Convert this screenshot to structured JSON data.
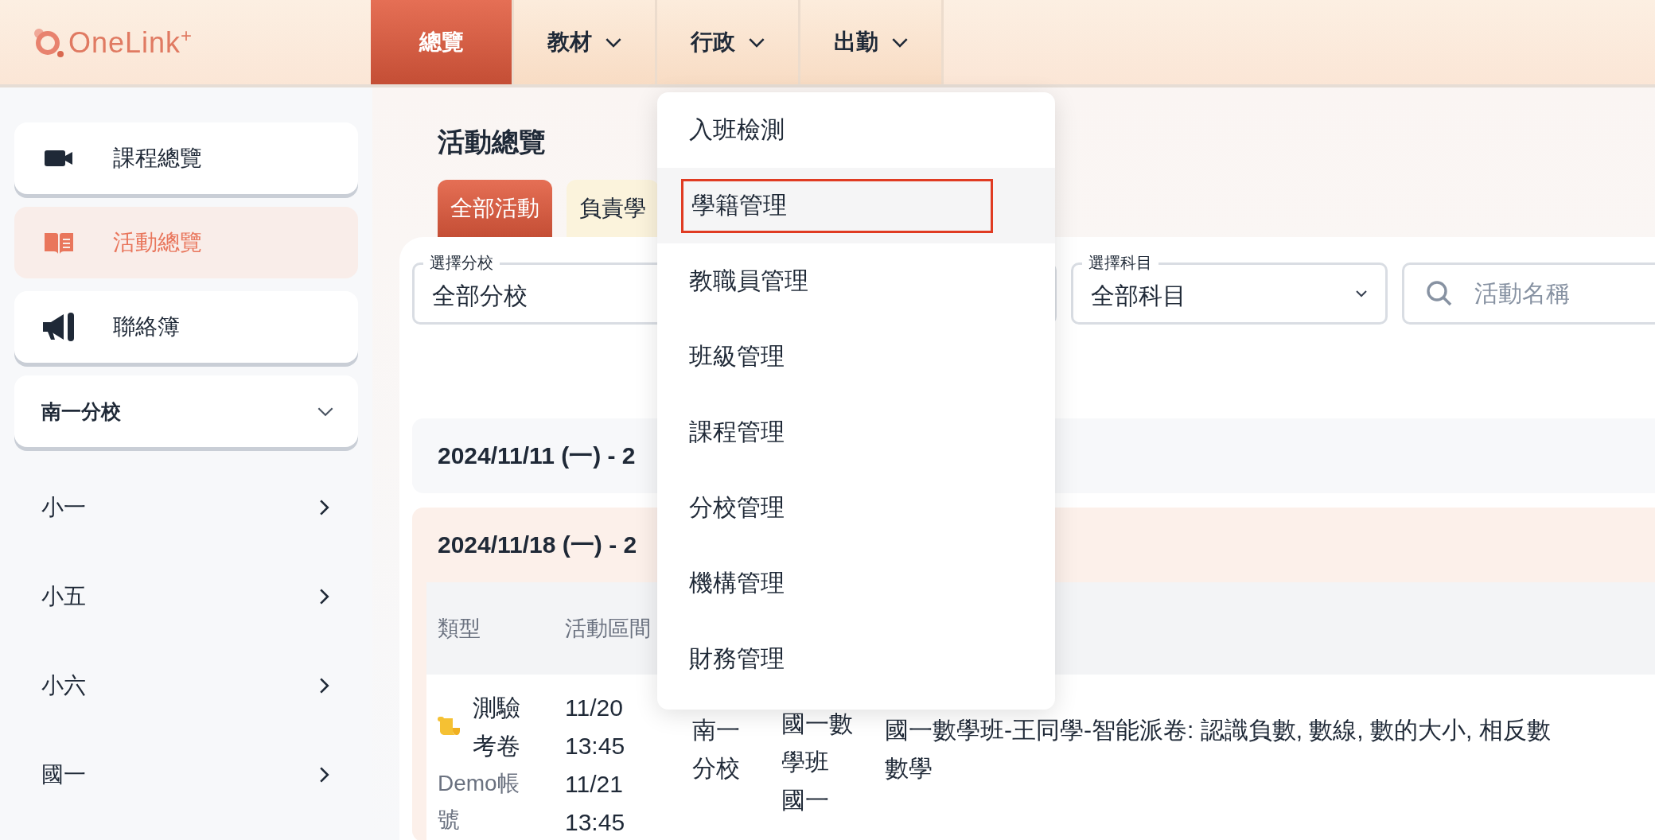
{
  "brand": {
    "name": "OneLink",
    "mark": "+"
  },
  "nav": [
    {
      "label": "總覽",
      "selected": true,
      "has_menu": false
    },
    {
      "label": "教材",
      "selected": false,
      "has_menu": true
    },
    {
      "label": "行政",
      "selected": false,
      "has_menu": true
    },
    {
      "label": "出勤",
      "selected": false,
      "has_menu": true
    }
  ],
  "sidebar": {
    "items": [
      {
        "label": "課程總覽",
        "kind": "video",
        "selected": false
      },
      {
        "label": "活動總覽",
        "kind": "book",
        "selected": true
      },
      {
        "label": "聯絡簿",
        "kind": "megaphone",
        "selected": false
      }
    ],
    "branch": {
      "label": "南一分校",
      "expanded": true
    },
    "grades": [
      "小一",
      "小五",
      "小六",
      "國一"
    ]
  },
  "page": {
    "title": "活動總覽",
    "tabs": [
      {
        "label": "全部活動",
        "selected": true
      },
      {
        "label": "負責學",
        "selected": false
      }
    ],
    "filters": [
      {
        "label": "選擇分校",
        "value": "全部分校"
      },
      {
        "label": "選擇科目",
        "value": "全部科目"
      }
    ],
    "search": {
      "placeholder": "活動名稱"
    },
    "weeks": [
      {
        "label": "2024/11/11 (一) - 2",
        "expanded": false
      },
      {
        "label": "2024/11/18 (一) - 2",
        "expanded": true
      }
    ],
    "table": {
      "columns": [
        "類型",
        "活動區間"
      ],
      "rows": [
        {
          "type": "測驗考卷",
          "owner": "Demo帳號",
          "start": "11/20 13:45",
          "end": "11/21 13:45",
          "branch": "南一分校",
          "class": "國一數學班",
          "grade": "國一",
          "name": "國一數學班-王同學-智能派卷: 認識負數, 數線, 數的大小, 相反數",
          "subject": "數學"
        }
      ]
    }
  },
  "admin_menu": {
    "items": [
      {
        "label": "入班檢測",
        "highlighted": false
      },
      {
        "label": "學籍管理",
        "highlighted": true
      },
      {
        "label": "教職員管理",
        "highlighted": false
      },
      {
        "label": "班級管理",
        "highlighted": false
      },
      {
        "label": "課程管理",
        "highlighted": false
      },
      {
        "label": "分校管理",
        "highlighted": false
      },
      {
        "label": "機構管理",
        "highlighted": false
      },
      {
        "label": "財務管理",
        "highlighted": false
      }
    ]
  }
}
